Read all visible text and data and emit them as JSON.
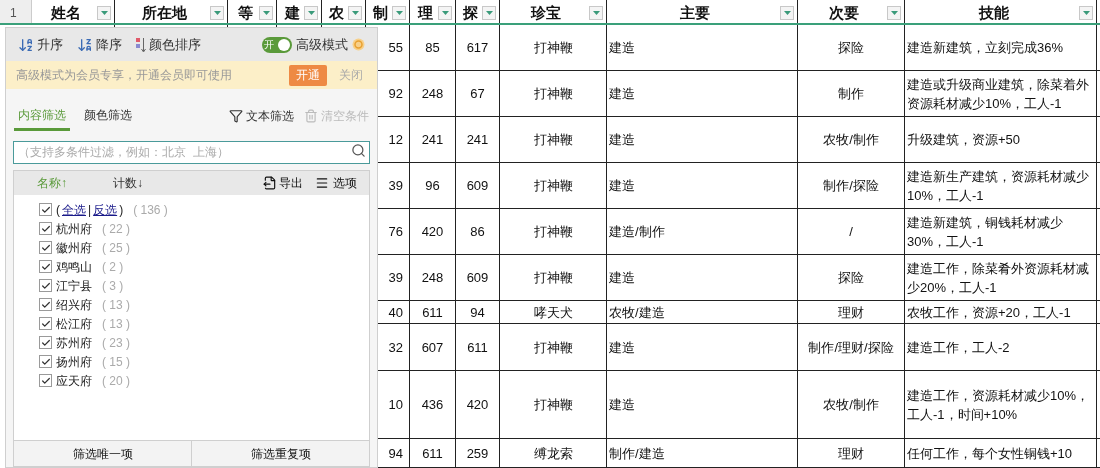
{
  "sheet": {
    "row_number": "1",
    "columns": [
      {
        "label": "姓名"
      },
      {
        "label": "所在地"
      },
      {
        "label": "等"
      },
      {
        "label": "建"
      },
      {
        "label": "农"
      },
      {
        "label": "制"
      },
      {
        "label": "理"
      },
      {
        "label": "探"
      },
      {
        "label": "珍宝"
      },
      {
        "label": "主要"
      },
      {
        "label": "次要"
      },
      {
        "label": "技能"
      }
    ],
    "rows": [
      {
        "cells": [
          "",
          "",
          "",
          "",
          "",
          "55",
          "85",
          "617",
          "打神鞭",
          "建造",
          "探险",
          "建造新建筑，立刻完成36%"
        ]
      },
      {
        "cells": [
          "",
          "",
          "",
          "",
          "",
          "92",
          "248",
          "67",
          "打神鞭",
          "建造",
          "制作",
          "建造或升级商业建筑，除菜着外资源耗材减少10%，工人-1"
        ]
      },
      {
        "cells": [
          "",
          "",
          "",
          "",
          "",
          "12",
          "241",
          "241",
          "打神鞭",
          "建造",
          "农牧/制作",
          "升级建筑，资源+50"
        ]
      },
      {
        "cells": [
          "",
          "",
          "",
          "",
          "",
          "39",
          "96",
          "609",
          "打神鞭",
          "建造",
          "制作/探险",
          "建造新生产建筑，资源耗材减少10%，工人-1"
        ]
      },
      {
        "cells": [
          "",
          "",
          "",
          "",
          "",
          "76",
          "420",
          "86",
          "打神鞭",
          "建造/制作",
          "/",
          "建造新建筑，铜钱耗材减少30%，工人-1"
        ]
      },
      {
        "cells": [
          "",
          "",
          "",
          "",
          "",
          "39",
          "248",
          "609",
          "打神鞭",
          "建造",
          "探险",
          "建造工作，除菜肴外资源耗材减少20%，工人-1"
        ]
      },
      {
        "cells": [
          "",
          "",
          "",
          "",
          "",
          "40",
          "611",
          "94",
          "哮天犬",
          "农牧/建造",
          "理财",
          "农牧工作，资源+20，工人-1"
        ]
      },
      {
        "cells": [
          "",
          "",
          "",
          "",
          "",
          "32",
          "607",
          "611",
          "打神鞭",
          "建造",
          "制作/理财/探险",
          "建造工作，工人-2"
        ]
      },
      {
        "cells": [
          "",
          "",
          "",
          "",
          "",
          "10",
          "436",
          "420",
          "打神鞭",
          "建造",
          "农牧/制作",
          "建造工作，资源耗材减少10%，工人-1，时间+10%"
        ]
      },
      {
        "cells": [
          "",
          "",
          "",
          "",
          "",
          "94",
          "611",
          "259",
          "缚龙索",
          "制作/建造",
          "理财",
          "任何工作，每个女性铜钱+10"
        ]
      }
    ]
  },
  "filter_panel": {
    "sort_buttons": [
      {
        "kind": "ascending",
        "label": "升序"
      },
      {
        "kind": "descending",
        "label": "降序"
      },
      {
        "kind": "color",
        "label": "颜色排序"
      }
    ],
    "advanced_mode": {
      "switch_text": "开",
      "on": true,
      "label": "高级模式"
    },
    "banner": {
      "text": "高级模式为会员专享，开通会员即可使用",
      "action": "开通",
      "close": "关闭"
    },
    "tabs": [
      {
        "label": "内容筛选",
        "selected": true
      },
      {
        "label": "颜色筛选",
        "selected": false
      }
    ],
    "text_filter": "文本筛选",
    "clear": {
      "label": "清空条件",
      "disabled": true
    },
    "search": {
      "placeholder": "（支持多条件过滤，例如：北京  上海）"
    },
    "sort_columns": [
      {
        "label": "名称↑",
        "selected": true
      },
      {
        "label": "计数↓",
        "selected": false
      }
    ],
    "export": "导出",
    "options": "选项",
    "items": [
      {
        "kind": "select_all",
        "prefix": "(",
        "links": [
          "全选",
          "反选"
        ],
        "separator": "|",
        "suffix": ")",
        "count": "( 136 )",
        "checked": true
      },
      {
        "kind": "value",
        "name": "杭州府",
        "count": "( 22 )",
        "checked": true
      },
      {
        "kind": "value",
        "name": "徽州府",
        "count": "( 25 )",
        "checked": true
      },
      {
        "kind": "value",
        "name": "鸡鸣山",
        "count": "( 2 )",
        "checked": true
      },
      {
        "kind": "value",
        "name": "江宁县",
        "count": "( 3 )",
        "checked": true
      },
      {
        "kind": "value",
        "name": "绍兴府",
        "count": "( 13 )",
        "checked": true
      },
      {
        "kind": "value",
        "name": "松江府",
        "count": "( 13 )",
        "checked": true
      },
      {
        "kind": "value",
        "name": "苏州府",
        "count": "( 23 )",
        "checked": true
      },
      {
        "kind": "value",
        "name": "扬州府",
        "count": "( 15 )",
        "checked": true
      },
      {
        "kind": "value",
        "name": "应天府",
        "count": "( 20 )",
        "checked": true
      }
    ],
    "footer_buttons": [
      "筛选唯一项",
      "筛选重复项"
    ]
  }
}
